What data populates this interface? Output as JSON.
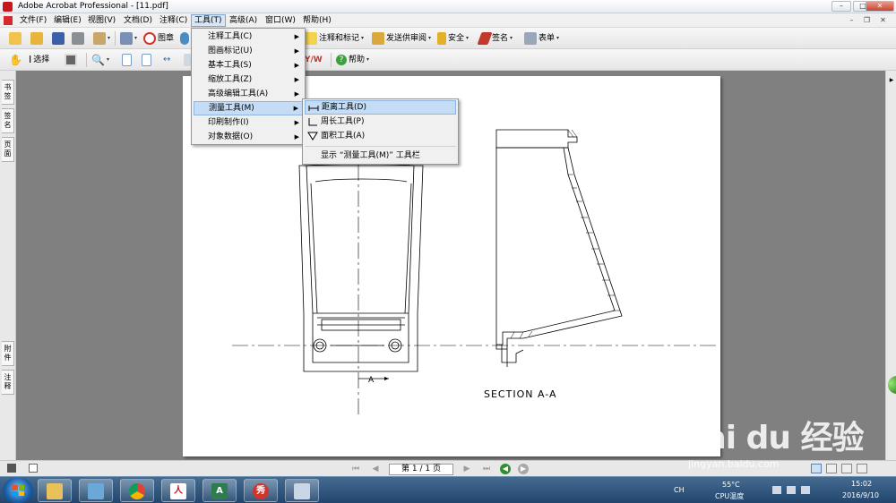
{
  "window": {
    "title": "Adobe Acrobat Professional - [11.pdf]"
  },
  "menubar": {
    "items": [
      "文件(F)",
      "编辑(E)",
      "视图(V)",
      "文档(D)",
      "注释(C)",
      "工具(T)",
      "高级(A)",
      "窗口(W)",
      "帮助(H)"
    ]
  },
  "toolbar1": {
    "stamp_label": "图章",
    "comment_markup_label": "注释和标记",
    "send_review_label": "发送供审阅",
    "security_label": "安全",
    "sign_label": "签名",
    "forms_label": "表单"
  },
  "toolbar2": {
    "select_label": "选择",
    "help_label": "帮助"
  },
  "navpanel": {
    "tabs": [
      "书签",
      "签名",
      "页面",
      "附件",
      "注释"
    ]
  },
  "tools_menu": {
    "items": [
      {
        "label": "注释工具(C)",
        "submenu": true
      },
      {
        "label": "图画标记(U)",
        "submenu": true
      },
      {
        "label": "基本工具(S)",
        "submenu": true
      },
      {
        "label": "缩放工具(Z)",
        "submenu": true
      },
      {
        "label": "高级编辑工具(A)",
        "submenu": true
      },
      {
        "label": "测量工具(M)",
        "submenu": true,
        "highlighted": true
      },
      {
        "label": "印刷制作(I)",
        "submenu": true
      },
      {
        "label": "对象数据(O)",
        "submenu": true
      }
    ]
  },
  "measure_submenu": {
    "items": [
      "距离工具(D)",
      "周长工具(P)",
      "面积工具(A)"
    ],
    "show_toolbar": "显示 “测量工具(M)” 工具栏"
  },
  "drawing": {
    "section_label": "SECTION  A-A",
    "marker_a": "A"
  },
  "statusbar": {
    "page_display": "第 1 / 1 页"
  },
  "taskbar": {
    "lang": "CH",
    "cpu_temp": "55°C",
    "cpu_label": "CPU温度",
    "time": "15:02",
    "date": "2016/9/10"
  },
  "watermark": {
    "brand": "Bai du 经验",
    "url": "jingyan.baidu.com"
  }
}
